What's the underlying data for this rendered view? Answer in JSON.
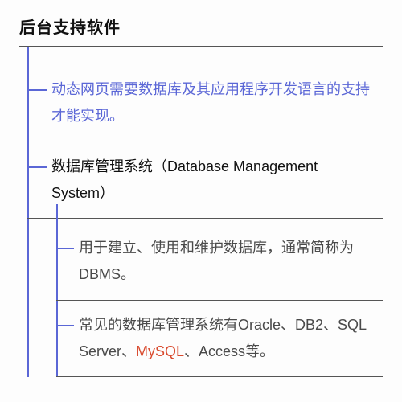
{
  "title": "后台支持软件",
  "intro": "动态网页需要数据库及其应用程序开发语言的支持才能实现。",
  "section": {
    "heading": "数据库管理系统（Database Management System）",
    "items": [
      {
        "pre": "用于建立、使用和维护数据库，通常简称为DBMS。",
        "hl": "",
        "post": ""
      },
      {
        "pre": "常见的数据库管理系统有Oracle、DB2、SQL Server、",
        "hl": "MySQL",
        "post": "、Access等。"
      }
    ]
  }
}
